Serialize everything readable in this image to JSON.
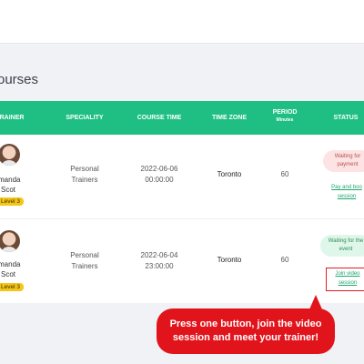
{
  "section": {
    "title": "ourses"
  },
  "table": {
    "headers": {
      "trainer": "RAINER",
      "speciality": "SPECIALITY",
      "course_time": "COURSE TIME",
      "time_zone": "TIME ZONE",
      "period": "PERIOD",
      "period_unit": "Minutes",
      "status": "STATUS"
    },
    "rows": [
      {
        "name_line1": "manda",
        "name_line2": "Scot",
        "level": "Level 3",
        "speciality_line1": "Personal",
        "speciality_line2": "Trainers",
        "date": "2022-06-06",
        "time": "00:00:00",
        "time_zone": "Toronto",
        "period": "60",
        "status_line1": "Waiting for",
        "status_line2": "payment",
        "action_line1": "Pay and boo",
        "action_line2": "session"
      },
      {
        "name_line1": "manda",
        "name_line2": "Scot",
        "level": "Level 3",
        "speciality_line1": "Personal",
        "speciality_line2": "Trainers",
        "date": "2022-06-04",
        "time": "23:00:00",
        "time_zone": "Toronto",
        "period": "60",
        "status_line1": "Waiting for the",
        "status_line2": "event",
        "action_line1": "Join video",
        "action_line2": "session"
      }
    ]
  },
  "callout": {
    "text": "Press one button, join the video\nsession  and meet your trainer!"
  },
  "colors": {
    "header": "#1fbf84",
    "callout": "#e1141c",
    "level_badge": "#f5c518"
  }
}
